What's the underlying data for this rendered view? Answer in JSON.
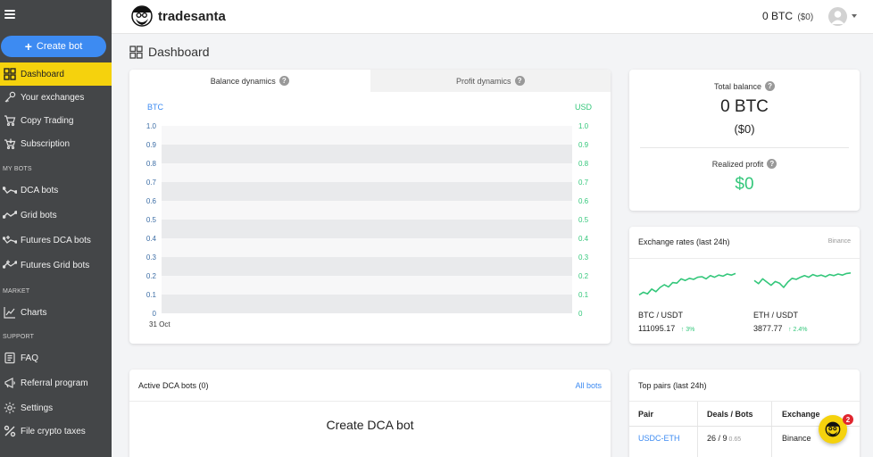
{
  "brand": {
    "name": "tradesanta"
  },
  "header": {
    "btc_balance": "0 BTC",
    "usd_balance": "($0)"
  },
  "sidebar": {
    "create_label": "Create bot",
    "items": [
      {
        "label": "Dashboard"
      },
      {
        "label": "Your exchanges"
      },
      {
        "label": "Copy Trading"
      },
      {
        "label": "Subscription"
      },
      {
        "label": "DCA bots"
      },
      {
        "label": "Grid bots"
      },
      {
        "label": "Futures DCA bots"
      },
      {
        "label": "Futures Grid bots"
      },
      {
        "label": "Charts"
      },
      {
        "label": "FAQ"
      },
      {
        "label": "Referral program"
      },
      {
        "label": "Settings"
      },
      {
        "label": "File crypto taxes"
      }
    ],
    "sections": {
      "my_bots": "MY BOTS",
      "market": "MARKET",
      "support": "SUPPORT"
    }
  },
  "page": {
    "title": "Dashboard"
  },
  "chart": {
    "tabs": [
      {
        "label": "Balance dynamics"
      },
      {
        "label": "Profit dynamics"
      }
    ],
    "left_unit": "BTC",
    "right_unit": "USD",
    "ticks": [
      "1.0",
      "0.9",
      "0.8",
      "0.7",
      "0.6",
      "0.5",
      "0.4",
      "0.3",
      "0.2",
      "0.1",
      "0"
    ],
    "date_label": "31 Oct"
  },
  "balance": {
    "total_label": "Total balance",
    "btc": "0 BTC",
    "usd": "($0)",
    "profit_label": "Realized profit",
    "profit": "$0"
  },
  "rates": {
    "title": "Exchange rates (last 24h)",
    "source": "Binance",
    "pairs": [
      {
        "name": "BTC / USDT",
        "price": "111095.17",
        "change": "3%",
        "trend": [
          0.12,
          0.22,
          0.16,
          0.34,
          0.24,
          0.4,
          0.5,
          0.42,
          0.58,
          0.56,
          0.72,
          0.66,
          0.74,
          0.7,
          0.78,
          0.8,
          0.72,
          0.84,
          0.78,
          0.86,
          0.82,
          0.9,
          0.86,
          0.92
        ]
      },
      {
        "name": "ETH / USDT",
        "price": "3877.77",
        "change": "2.4%",
        "trend": [
          0.66,
          0.54,
          0.72,
          0.6,
          0.48,
          0.62,
          0.56,
          0.4,
          0.6,
          0.74,
          0.7,
          0.78,
          0.84,
          0.78,
          0.88,
          0.82,
          0.86,
          0.8,
          0.88,
          0.84,
          0.9,
          0.86,
          0.92,
          0.94
        ]
      }
    ],
    "up_arrow": "↑",
    "colors": {
      "up": "#34c77b"
    }
  },
  "active_bots": {
    "title": "Active DCA bots (0)",
    "all_link": "All bots",
    "empty_action": "Create DCA bot"
  },
  "top_pairs": {
    "title": "Top pairs (last 24h)",
    "headers": [
      "Pair",
      "Deals / Bots",
      "Exchange"
    ],
    "rows": [
      {
        "pair": "USDC-ETH",
        "deals": "26 / 9",
        "ratio": "0.65",
        "exchange": "Binance"
      }
    ]
  },
  "help": {
    "badge": "2"
  },
  "theme": {
    "accent": "#3d8bf2",
    "highlight": "#f5d20d",
    "sidebar_bg": "#444648"
  }
}
